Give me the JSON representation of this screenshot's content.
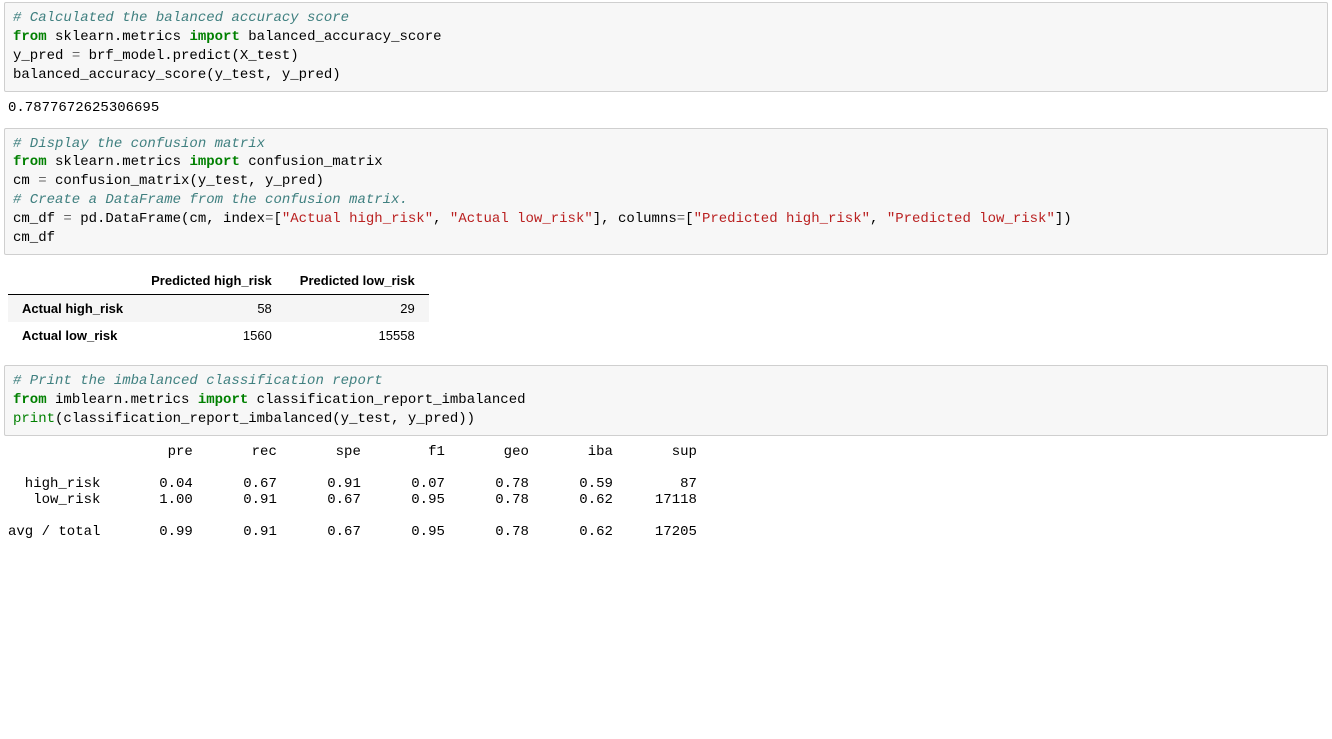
{
  "cell1": {
    "comment1": "# Calculated the balanced accuracy score",
    "l1_from": "from",
    "l1_mod": " sklearn.metrics ",
    "l1_import": "import",
    "l1_name": " balanced_accuracy_score",
    "l2_var": "y_pred ",
    "l2_eq": "=",
    "l2_rest": " brf_model.predict(X_test)",
    "l3": "balanced_accuracy_score(y_test, y_pred)"
  },
  "out1": "0.7877672625306695",
  "cell2": {
    "comment1": "# Display the confusion matrix",
    "l1_from": "from",
    "l1_mod": " sklearn.metrics ",
    "l1_import": "import",
    "l1_name": " confusion_matrix",
    "l2_var": "cm ",
    "l2_eq": "=",
    "l2_rest": " confusion_matrix(y_test, y_pred)",
    "comment2": "# Create a DataFrame from the confusion matrix.",
    "l3_a": "cm_df ",
    "l3_eq": "=",
    "l3_b": " pd.DataFrame(cm, index",
    "l3_eq2": "=",
    "l3_c": "[",
    "l3_s1": "\"Actual high_risk\"",
    "l3_d": ", ",
    "l3_s2": "\"Actual low_risk\"",
    "l3_e": "], columns",
    "l3_eq3": "=",
    "l3_f": "[",
    "l3_s3": "\"Predicted high_risk\"",
    "l3_g": ", ",
    "l3_s4": "\"Predicted low_risk\"",
    "l3_h": "])",
    "l4": "cm_df"
  },
  "df": {
    "cols": [
      "Predicted high_risk",
      "Predicted low_risk"
    ],
    "rows": [
      {
        "idx": "Actual high_risk",
        "c0": "58",
        "c1": "29"
      },
      {
        "idx": "Actual low_risk",
        "c0": "1560",
        "c1": "15558"
      }
    ]
  },
  "cell3": {
    "comment1": "# Print the imbalanced classification report",
    "l1_from": "from",
    "l1_mod": " imblearn.metrics ",
    "l1_import": "import",
    "l1_name": " classification_report_imbalanced",
    "l2_print": "print",
    "l2_rest": "(classification_report_imbalanced(y_test, y_pred))"
  },
  "report": "                   pre       rec       spe        f1       geo       iba       sup\n\n  high_risk       0.04      0.67      0.91      0.07      0.78      0.59        87\n   low_risk       1.00      0.91      0.67      0.95      0.78      0.62     17118\n\navg / total       0.99      0.91      0.67      0.95      0.78      0.62     17205\n"
}
